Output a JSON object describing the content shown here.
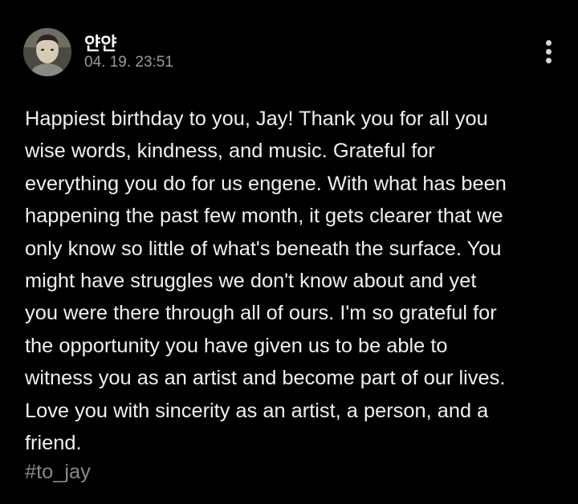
{
  "post": {
    "author": "얀얀",
    "timestamp": "04. 19. 23:51",
    "more_icon": "more-vertical-icon",
    "body": "Happiest birthday to you, Jay! Thank you for all you\nwise words, kindness, and music. Grateful for\neverything you do for us engene. With what has been\nhappening the past few month, it gets clearer that we\nonly know so little of what's beneath the surface. You\nmight have struggles we don't know about and yet\nyou were there through all of ours. I'm so grateful for\nthe opportunity you have given us to be able to\nwitness you as an artist and become part of our lives.\nLove you with sincerity as an artist, a person, and a\nfriend.",
    "hashtag": "#to_jay"
  },
  "colors": {
    "background": "#000000",
    "text": "#f0f0f0",
    "muted": "#9a9a9a",
    "hashtag": "#8a8a8a"
  }
}
